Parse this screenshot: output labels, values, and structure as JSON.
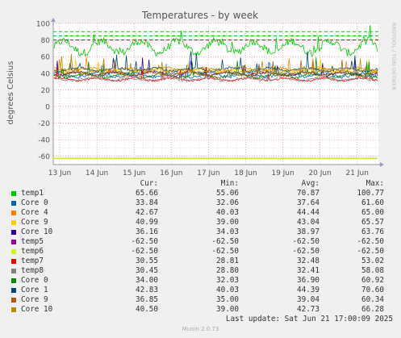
{
  "chart_data": {
    "type": "line",
    "title": "Temperatures - by week",
    "ylabel": "degrees Celsius",
    "side_label": "RRDTOOL / TOBI OETIKER",
    "ylim": [
      -70,
      100
    ],
    "yticks": [
      100,
      80,
      60,
      40,
      20,
      0,
      -20,
      -40,
      -60
    ],
    "x": [
      "13 Jun",
      "14 Jun",
      "15 Jun",
      "16 Jun",
      "17 Jun",
      "18 Jun",
      "19 Jun",
      "20 Jun",
      "21 Jun"
    ],
    "warning_levels": [
      {
        "value": 90,
        "color": "#00cc00"
      },
      {
        "value": 85,
        "color": "#00cc00"
      },
      {
        "value": 80,
        "color": "#cc0000"
      }
    ],
    "columns": [
      "Cur:",
      "Min:",
      "Avg:",
      "Max:"
    ],
    "series": [
      {
        "name": "temp1",
        "color": "#00cc00",
        "values": [
          "65.66",
          "55.06",
          "70.87",
          "100.77"
        ]
      },
      {
        "name": "Core 0",
        "color": "#0066b3",
        "values": [
          "33.84",
          "32.06",
          "37.64",
          "61.60"
        ]
      },
      {
        "name": "Core 4",
        "color": "#ff8000",
        "values": [
          "42.67",
          "40.03",
          "44.44",
          "65.00"
        ]
      },
      {
        "name": "Core 9",
        "color": "#ffcc00",
        "values": [
          "40.99",
          "39.00",
          "43.04",
          "65.57"
        ]
      },
      {
        "name": "Core 10",
        "color": "#330099",
        "values": [
          "36.16",
          "34.03",
          "38.97",
          "63.76"
        ]
      },
      {
        "name": "temp5",
        "color": "#990099",
        "values": [
          "-62.50",
          "-62.50",
          "-62.50",
          "-62.50"
        ]
      },
      {
        "name": "temp6",
        "color": "#ccff00",
        "values": [
          "-62.50",
          "-62.50",
          "-62.50",
          "-62.50"
        ]
      },
      {
        "name": "temp7",
        "color": "#ff0000",
        "values": [
          "30.55",
          "28.81",
          "32.48",
          "53.02"
        ]
      },
      {
        "name": "temp8",
        "color": "#808080",
        "values": [
          "30.45",
          "28.80",
          "32.41",
          "58.08"
        ]
      },
      {
        "name": "Core 0",
        "color": "#008f00",
        "values": [
          "34.00",
          "32.03",
          "36.90",
          "60.92"
        ]
      },
      {
        "name": "Core 1",
        "color": "#00487d",
        "values": [
          "42.83",
          "40.03",
          "44.39",
          "70.60"
        ]
      },
      {
        "name": "Core 9",
        "color": "#b35a00",
        "values": [
          "36.85",
          "35.00",
          "39.04",
          "60.34"
        ]
      },
      {
        "name": "Core 10",
        "color": "#b38f00",
        "values": [
          "40.50",
          "39.00",
          "42.73",
          "66.28"
        ]
      }
    ]
  },
  "last_update": "Last update: Sat Jun 21 17:00:09 2025",
  "footer": "Munin 2.0.73"
}
